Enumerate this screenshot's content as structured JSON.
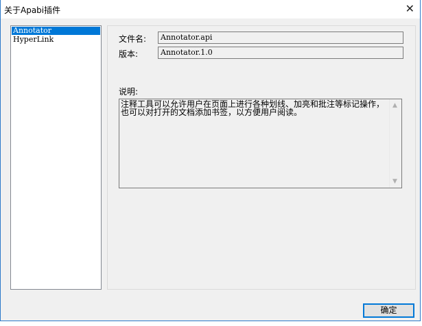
{
  "window": {
    "title": "关于Apabi插件",
    "close_icon": "close-icon"
  },
  "plugins": [
    {
      "label": "Annotator",
      "selected": true
    },
    {
      "label": "HyperLink",
      "selected": false
    }
  ],
  "details": {
    "filename_label": "文件名:",
    "filename_value": "Annotator.api",
    "version_label": "版本:",
    "version_value": "Annotator.1.0",
    "description_label": "说明:",
    "description": "注释工具可以允许用户在页面上进行各种划线、加亮和批注等标记操作，也可以对打开的文档添加书签，以方便用户阅读。"
  },
  "buttons": {
    "ok": "确定"
  },
  "colors": {
    "accent": "#0078d7"
  }
}
